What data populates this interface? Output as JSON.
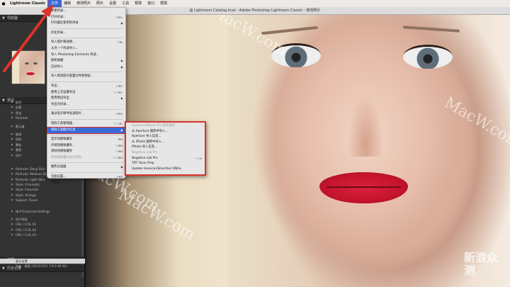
{
  "menubar": {
    "apple_icon": "apple-icon",
    "app_name": "Lightroom Classic",
    "items": [
      "文件",
      "编辑",
      "修改照片",
      "照片",
      "设置",
      "工具",
      "帮助",
      "窗口",
      "帮助"
    ]
  },
  "window": {
    "title": "Lightroom Catalog.lrcat - Adobe Photoshop Lightroom Classic - 修改照片"
  },
  "left_panel": {
    "navigator_title": "导航器",
    "presets_title": "预设",
    "presets": [
      {
        "label": "颜色",
        "kind": "item"
      },
      {
        "label": "创意",
        "kind": "item"
      },
      {
        "label": "黑白",
        "kind": "item"
      },
      {
        "label": "Portraits",
        "kind": "item"
      },
      {
        "label": "",
        "kind": "gap"
      },
      {
        "label": "默认值",
        "kind": "item"
      },
      {
        "label": "",
        "kind": "gap"
      },
      {
        "label": "曲线",
        "kind": "item"
      },
      {
        "label": "锐化",
        "kind": "item"
      },
      {
        "label": "颗粒",
        "kind": "item"
      },
      {
        "label": "晕影",
        "kind": "item"
      },
      {
        "label": "用户",
        "kind": "item"
      },
      {
        "label": "",
        "kind": "gap"
      },
      {
        "label": "",
        "kind": "gap"
      },
      {
        "label": "",
        "kind": "gap"
      },
      {
        "label": "Portraits: Deep Skin",
        "kind": "item"
      },
      {
        "label": "Portraits: Medium Skin",
        "kind": "item"
      },
      {
        "label": "Portraits: Light Skin",
        "kind": "item"
      },
      {
        "label": "Style: Cinematic",
        "kind": "item"
      },
      {
        "label": "Style: Futuristic",
        "kind": "item"
      },
      {
        "label": "Style: Vintage",
        "kind": "item"
      },
      {
        "label": "Subject: Travel",
        "kind": "item"
      },
      {
        "label": "",
        "kind": "gap"
      },
      {
        "label": "",
        "kind": "gap"
      },
      {
        "label": "NLP Enhanced Settings",
        "kind": "item"
      },
      {
        "label": "",
        "kind": "gap"
      },
      {
        "label": "用户预设",
        "kind": "item"
      },
      {
        "label": "CN1 / Cr5L 01",
        "kind": "item"
      },
      {
        "label": "CN1 / Cr5L 02",
        "kind": "item"
      },
      {
        "label": "CN1 / Cr5L 03",
        "kind": "item"
      }
    ],
    "snapshots_title": "快照",
    "history_title": "历史记录",
    "history": [
      {
        "label": "复位设置"
      },
      {
        "label": "导出 - 硬盘 (2021/12/1 下午2:48:46)"
      }
    ]
  },
  "file_menu": {
    "items": [
      {
        "label": "新建目录...",
        "shortcut": "",
        "kind": "item"
      },
      {
        "label": "打开目录...",
        "shortcut": "⇧⌘O",
        "kind": "item"
      },
      {
        "label": "打开最近使用的目录",
        "shortcut": "",
        "kind": "submenu"
      },
      {
        "kind": "sep"
      },
      {
        "label": "优化目录...",
        "shortcut": "",
        "kind": "item"
      },
      {
        "kind": "sep"
      },
      {
        "label": "导入照片和视频...",
        "shortcut": "⇧⌘I",
        "kind": "item"
      },
      {
        "label": "从另一个目录导入...",
        "shortcut": "",
        "kind": "item"
      },
      {
        "label": "导入 Photoshop Elements 目录...",
        "shortcut": "",
        "kind": "item"
      },
      {
        "label": "联机拍摄",
        "shortcut": "",
        "kind": "submenu"
      },
      {
        "label": "自动导入",
        "shortcut": "",
        "kind": "submenu"
      },
      {
        "kind": "sep"
      },
      {
        "label": "导入修改照片配置文件和预设...",
        "shortcut": "",
        "kind": "item"
      },
      {
        "kind": "sep"
      },
      {
        "label": "导出...",
        "shortcut": "⇧⌘E",
        "kind": "item"
      },
      {
        "label": "使用上次设置导出",
        "shortcut": "⌥⇧⌘E",
        "kind": "item"
      },
      {
        "label": "使用预设导出",
        "shortcut": "",
        "kind": "submenu"
      },
      {
        "label": "导出为目录...",
        "shortcut": "",
        "kind": "item"
      },
      {
        "kind": "sep"
      },
      {
        "label": "通过电子邮件发送照片...",
        "shortcut": "⇧⌘M",
        "kind": "item"
      },
      {
        "kind": "sep"
      },
      {
        "label": "增效工具管理器...",
        "shortcut": "⌥⇧⌘,",
        "kind": "item"
      },
      {
        "label": "增效工具额外信息",
        "shortcut": "",
        "kind": "submenu",
        "highlight": true
      },
      {
        "kind": "sep"
      },
      {
        "label": "显示快捷收藏夹",
        "shortcut": "⌘B",
        "kind": "item"
      },
      {
        "label": "存储快捷收藏夹...",
        "shortcut": "⌥⌘B",
        "kind": "item"
      },
      {
        "label": "清除快捷收藏夹",
        "shortcut": "⇧⌘B",
        "kind": "item"
      },
      {
        "label": "将快捷收藏夹设为目标",
        "shortcut": "⌥⇧⌘B",
        "kind": "disabled"
      },
      {
        "kind": "sep"
      },
      {
        "label": "图库过滤器",
        "shortcut": "",
        "kind": "submenu"
      },
      {
        "kind": "sep"
      },
      {
        "label": "页面设置...",
        "shortcut": "⇧⌘P",
        "kind": "item"
      },
      {
        "label": "打印机...",
        "shortcut": "⌘P",
        "kind": "item"
      }
    ]
  },
  "submenu": {
    "items": [
      {
        "label": "Aperture/iPhoto 导入程序插件",
        "kind": "disabled"
      },
      {
        "label": "从 Aperture 图库中导入...",
        "kind": "item"
      },
      {
        "label": "Aperture 导入信息...",
        "kind": "item"
      },
      {
        "label": "从 iPhoto 图库中导入...",
        "kind": "item"
      },
      {
        "label": "iPhoto 导入信息...",
        "kind": "item"
      },
      {
        "label": "Negative Lab Pro",
        "kind": "disabled"
      },
      {
        "label": "Negative Lab Pro",
        "shortcut": "^⌥N",
        "kind": "item"
      },
      {
        "label": "TIFF Scan Prep",
        "kind": "item"
      },
      {
        "label": "Update Vuescan/Silverfast DNGs",
        "kind": "item"
      }
    ]
  },
  "watermarks": [
    "MacW.com",
    "MacW.com",
    "MacW.com",
    "MacW.com"
  ],
  "corner_badge": "新浪众测",
  "colors": {
    "menu_highlight": "#3a6ad8",
    "annotation_red": "#d9342b",
    "lip_red": "#c4142c"
  }
}
